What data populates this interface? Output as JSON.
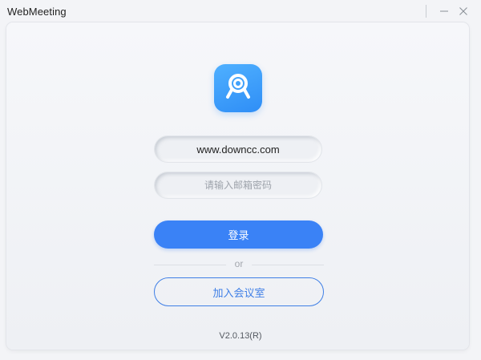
{
  "window": {
    "title": "WebMeeting",
    "minimize_icon": "minimize-icon",
    "close_icon": "close-icon"
  },
  "logo": {
    "icon": "webcam-icon",
    "colors": {
      "from": "#4fb0ff",
      "to": "#2f8ef6"
    }
  },
  "form": {
    "username_value": "www.downcc.com",
    "password_placeholder": "请输入邮箱密码",
    "login_label": "登录",
    "or_label": "or",
    "join_label": "加入会议室"
  },
  "footer": {
    "version": "V2.0.13(R)"
  },
  "colors": {
    "accent": "#3a82f6",
    "background": "#f3f4f7"
  }
}
